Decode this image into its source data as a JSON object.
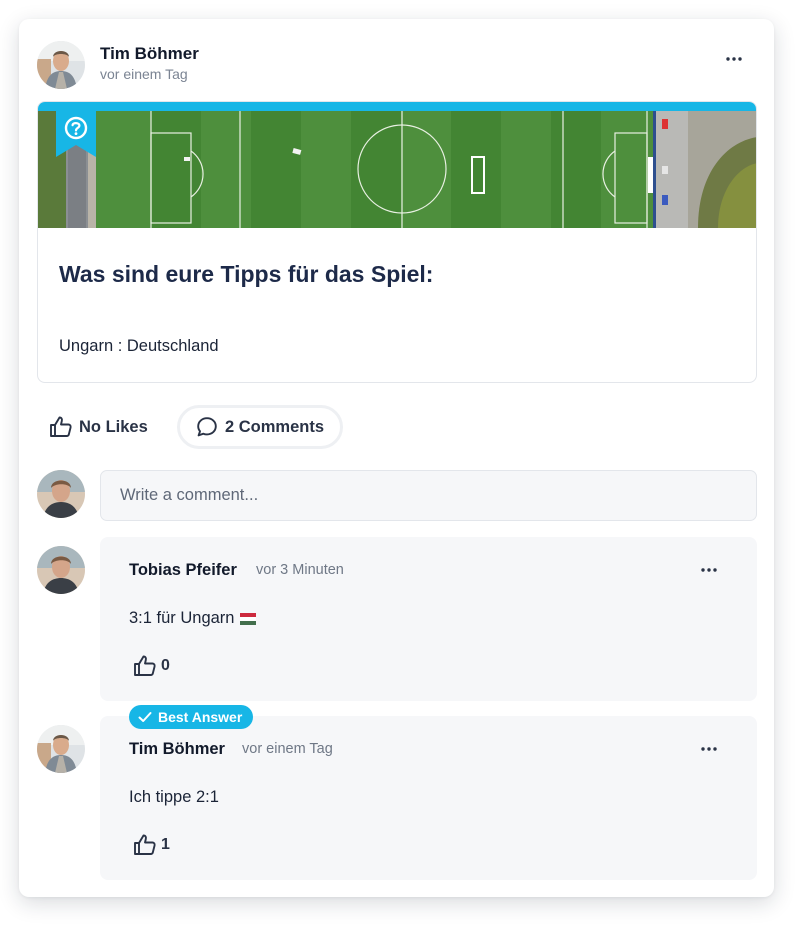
{
  "post": {
    "author": "Tim Böhmer",
    "time": "vor einem Tag",
    "question_title": "Was sind eure Tipps für das Spiel:",
    "question_body": "Ungarn : Deutschland"
  },
  "actions": {
    "likes_label": "No Likes",
    "comments_label": "2 Comments"
  },
  "comment_input": {
    "placeholder": "Write a comment..."
  },
  "comments": [
    {
      "author": "Tobias Pfeifer",
      "time": "vor 3 Minuten",
      "text": "3:1 für Ungarn",
      "likes": "0",
      "flag_icon": "hungary-flag-icon"
    },
    {
      "author": "Tim Böhmer",
      "time": "vor einem Tag",
      "text": "Ich tippe 2:1",
      "likes": "1",
      "badge": "Best Answer"
    }
  ],
  "colors": {
    "accent": "#17b6e6",
    "title": "#1d2a49",
    "comment_bg": "#f6f7f9",
    "border": "#e3e6eb"
  }
}
